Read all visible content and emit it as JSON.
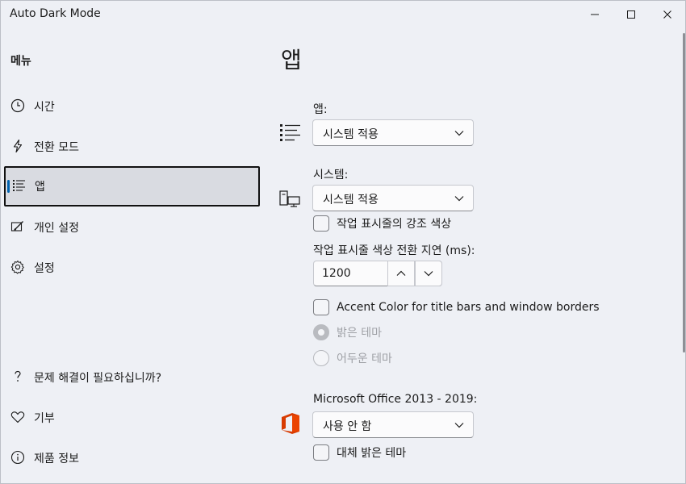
{
  "window": {
    "title": "Auto Dark Mode"
  },
  "sidebar": {
    "menu_label": "메뉴",
    "items": [
      {
        "label": "시간",
        "icon": "clock-icon"
      },
      {
        "label": "전환 모드",
        "icon": "lightning-icon"
      },
      {
        "label": "앱",
        "icon": "list-icon",
        "selected": true
      },
      {
        "label": "개인 설정",
        "icon": "personalize-icon"
      },
      {
        "label": "설정",
        "icon": "gear-icon"
      }
    ],
    "footer_items": [
      {
        "label": "문제 해결이 필요하십니까?",
        "icon": "question-icon"
      },
      {
        "label": "기부",
        "icon": "heart-icon"
      },
      {
        "label": "제품 정보",
        "icon": "info-icon"
      }
    ]
  },
  "main": {
    "title": "앱",
    "apps": {
      "label": "앱:",
      "value": "시스템 적용"
    },
    "system": {
      "label": "시스템:",
      "value": "시스템 적용",
      "taskbar_accent_label": "작업 표시줄의 강조 색상",
      "delay_label": "작업 표시줄 색상 전환 지연 (ms):",
      "delay_value": "1200",
      "accent_title_label": "Accent Color for title bars and window borders",
      "radio_light": "밝은 테마",
      "radio_dark": "어두운 테마"
    },
    "office": {
      "label": "Microsoft Office 2013 - 2019:",
      "value": "사용 안 함",
      "alt_light_label": "대체 밝은 테마"
    }
  },
  "colors": {
    "accent": "#0063b1",
    "office_icon": "#d83b01"
  }
}
